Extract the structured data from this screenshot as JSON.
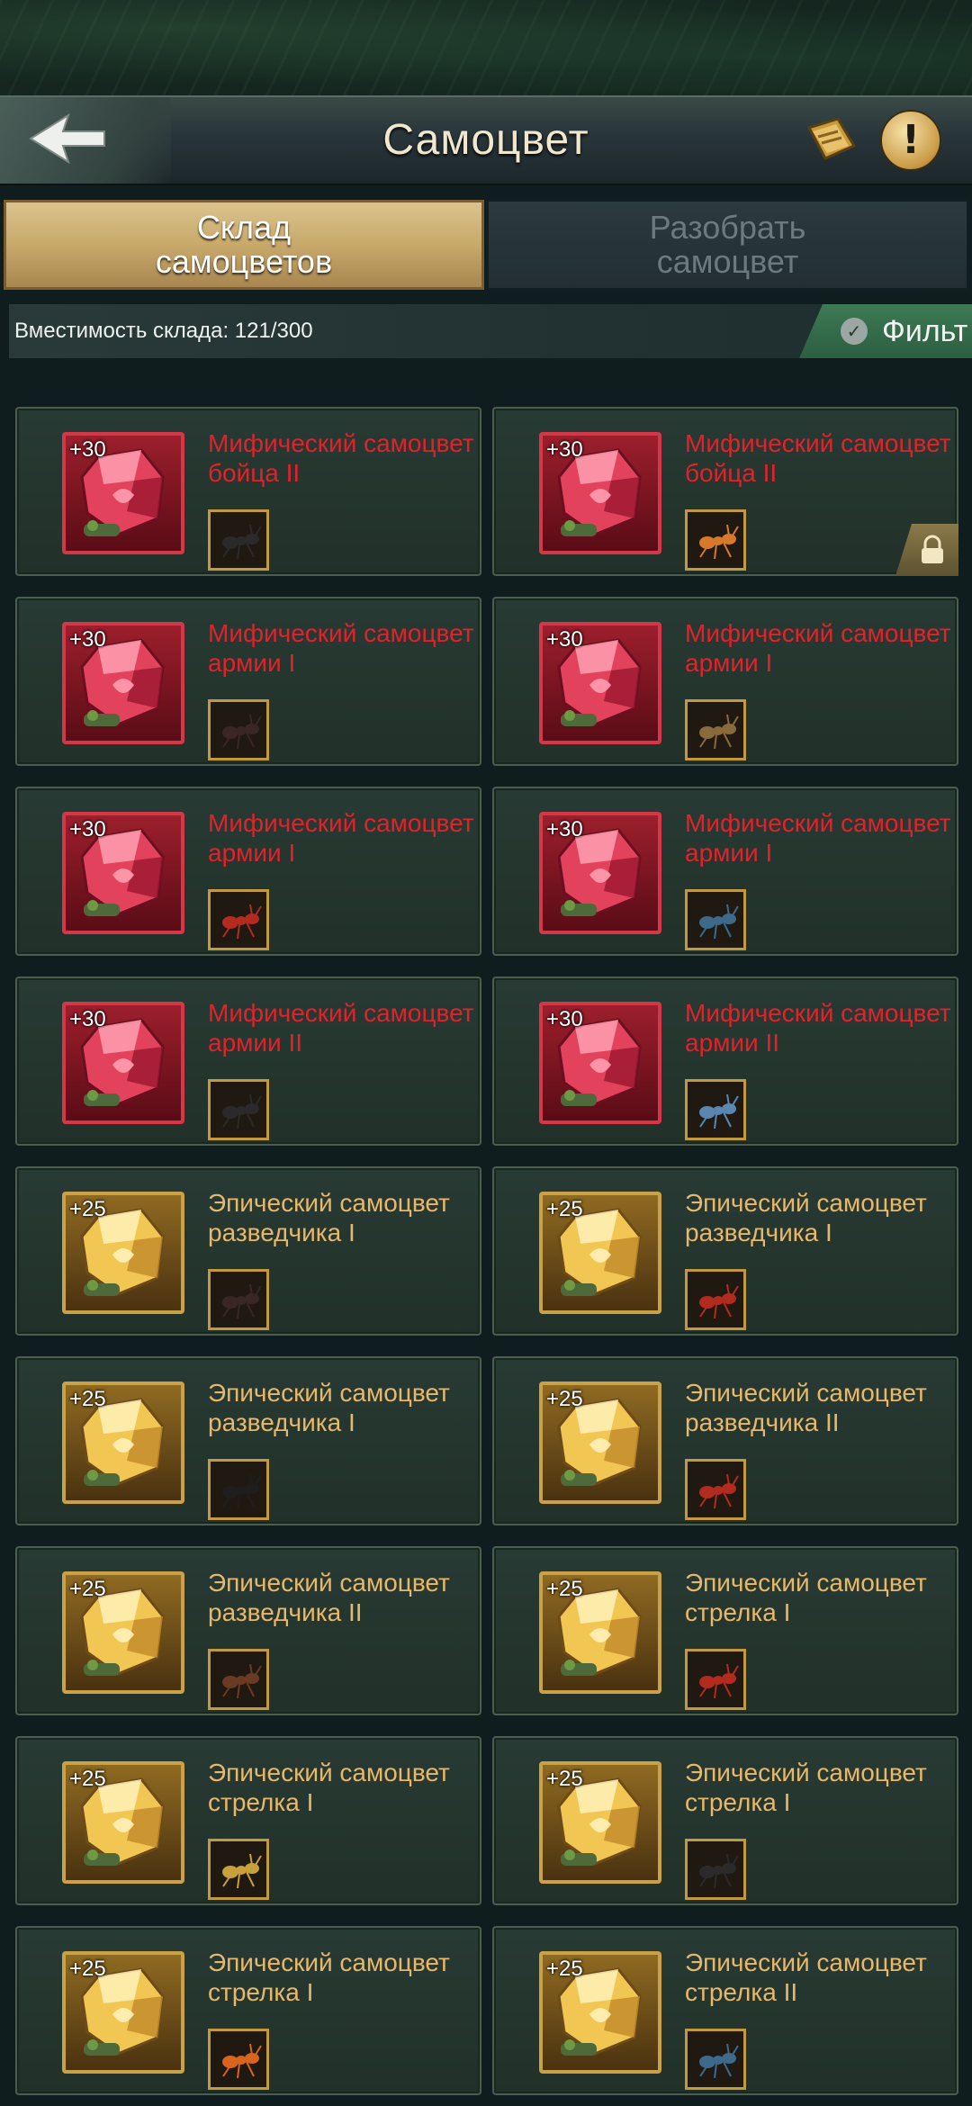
{
  "header": {
    "title": "Самоцвет"
  },
  "tabs": [
    {
      "label": "Склад самоцветов",
      "active": true
    },
    {
      "label": "Разобрать самоцвет",
      "active": false
    }
  ],
  "capacity": {
    "text": "Вместимость склада: 121/300"
  },
  "filter": {
    "label": "Фильт"
  },
  "colors": {
    "mythic_text": "#e2222b",
    "epic_text": "#e7b86a",
    "active_tab": "#c8a96a"
  },
  "gems": [
    {
      "level": "+30",
      "name": "Мифический самоцвет бойца II",
      "rarity": "mythic",
      "unit": "black-beetle",
      "locked": false
    },
    {
      "level": "+30",
      "name": "Мифический самоцвет бойца II",
      "rarity": "mythic",
      "unit": "orange-ant",
      "locked": true
    },
    {
      "level": "+30",
      "name": "Мифический самоцвет армии I",
      "rarity": "mythic",
      "unit": "dark-ant",
      "locked": false
    },
    {
      "level": "+30",
      "name": "Мифический самоцвет армии I",
      "rarity": "mythic",
      "unit": "armored-warrior",
      "locked": false
    },
    {
      "level": "+30",
      "name": "Мифический самоцвет армии I",
      "rarity": "mythic",
      "unit": "red-ant",
      "locked": false
    },
    {
      "level": "+30",
      "name": "Мифический самоцвет армии I",
      "rarity": "mythic",
      "unit": "blue-beetle",
      "locked": false
    },
    {
      "level": "+30",
      "name": "Мифический самоцвет армии II",
      "rarity": "mythic",
      "unit": "black-beetle",
      "locked": false
    },
    {
      "level": "+30",
      "name": "Мифический самоцвет армии II",
      "rarity": "mythic",
      "unit": "blue-mantis",
      "locked": false
    },
    {
      "level": "+25",
      "name": "Эпический самоцвет разведчика I",
      "rarity": "epic",
      "unit": "dark-ant",
      "locked": false
    },
    {
      "level": "+25",
      "name": "Эпический самоцвет разведчика I",
      "rarity": "epic",
      "unit": "red-ant",
      "locked": false
    },
    {
      "level": "+25",
      "name": "Эпический самоцвет разведчика I",
      "rarity": "epic",
      "unit": "black-spider",
      "locked": false
    },
    {
      "level": "+25",
      "name": "Эпический самоцвет разведчика II",
      "rarity": "epic",
      "unit": "red-ant",
      "locked": false
    },
    {
      "level": "+25",
      "name": "Эпический самоцвет разведчика II",
      "rarity": "epic",
      "unit": "brown-ant",
      "locked": false
    },
    {
      "level": "+25",
      "name": "Эпический самоцвет стрелка I",
      "rarity": "epic",
      "unit": "red-ant",
      "locked": false
    },
    {
      "level": "+25",
      "name": "Эпический самоцвет стрелка I",
      "rarity": "epic",
      "unit": "yellow-wasp",
      "locked": false
    },
    {
      "level": "+25",
      "name": "Эпический самоцвет стрелка I",
      "rarity": "epic",
      "unit": "black-beetle",
      "locked": false
    },
    {
      "level": "+25",
      "name": "Эпический самоцвет стрелка I",
      "rarity": "epic",
      "unit": "orange-spider",
      "locked": false
    },
    {
      "level": "+25",
      "name": "Эпический самоцвет стрелка II",
      "rarity": "epic",
      "unit": "blue-beetle",
      "locked": false
    }
  ]
}
